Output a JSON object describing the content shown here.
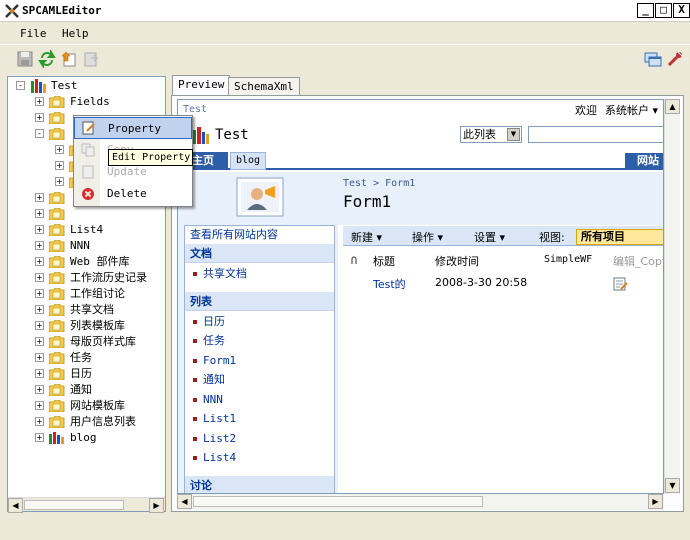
{
  "window": {
    "title": "SPCAMLEditor",
    "minimize": "_",
    "maximize": "□",
    "close": "X"
  },
  "menu": [
    "File",
    "Help"
  ],
  "toolbar": [
    "save-icon",
    "refresh-icon",
    "import-icon",
    "export-icon",
    "window-icon",
    "tool-icon"
  ],
  "tree": {
    "root": "Test",
    "items": [
      {
        "label": "Fields",
        "level": 1,
        "expand": "+"
      },
      {
        "label": "",
        "level": 1,
        "expand": "+"
      },
      {
        "label": "",
        "level": 1,
        "expand": "-"
      },
      {
        "label": "",
        "level": 2,
        "expand": "+"
      },
      {
        "label": "",
        "level": 2,
        "expand": "+"
      },
      {
        "label": "",
        "level": 2,
        "expand": "+"
      },
      {
        "label": "",
        "level": 1,
        "expand": "+"
      },
      {
        "label": "",
        "level": 1,
        "expand": "+"
      },
      {
        "label": "List4",
        "level": 1,
        "expand": "+"
      },
      {
        "label": "NNN",
        "level": 1,
        "expand": "+"
      },
      {
        "label": "Web 部件库",
        "level": 1,
        "expand": "+"
      },
      {
        "label": "工作流历史记录",
        "level": 1,
        "expand": "+"
      },
      {
        "label": "工作组讨论",
        "level": 1,
        "expand": "+"
      },
      {
        "label": "共享文档",
        "level": 1,
        "expand": "+"
      },
      {
        "label": "列表模板库",
        "level": 1,
        "expand": "+"
      },
      {
        "label": "母版页样式库",
        "level": 1,
        "expand": "+"
      },
      {
        "label": "任务",
        "level": 1,
        "expand": "+"
      },
      {
        "label": "日历",
        "level": 1,
        "expand": "+"
      },
      {
        "label": "通知",
        "level": 1,
        "expand": "+"
      },
      {
        "label": "网站模板库",
        "level": 1,
        "expand": "+"
      },
      {
        "label": "用户信息列表",
        "level": 1,
        "expand": "+"
      },
      {
        "label": "blog",
        "level": 1,
        "expand": "+"
      }
    ]
  },
  "context_menu": {
    "items": [
      {
        "label": "Property",
        "icon": "edit-icon",
        "highlighted": true
      },
      {
        "label": "Copy",
        "icon": "copy-icon",
        "disabled": true
      },
      {
        "label": "Update",
        "icon": "update-icon",
        "disabled": true
      },
      {
        "label": "Delete",
        "icon": "delete-icon"
      }
    ],
    "tooltip": "Edit Property"
  },
  "tabs": [
    "Preview",
    "SchemaXml"
  ],
  "preview": {
    "site_name_small": "Test",
    "welcome": "欢迎",
    "account": "系统帐户",
    "site_title": "Test",
    "search_scope": "此列表",
    "nav_home": "主页",
    "nav_blog": "blog",
    "nav_right": "网站",
    "breadcrumb": "Test > Form1",
    "page_title": "Form1",
    "view_all": "查看所有网站内容",
    "sections": [
      {
        "title": "文档",
        "items": [
          {
            "label": "共享文档"
          }
        ]
      },
      {
        "title": "列表",
        "items": [
          {
            "label": "日历"
          },
          {
            "label": "任务"
          },
          {
            "label": "Form1"
          },
          {
            "label": "通知"
          },
          {
            "label": "NNN"
          },
          {
            "label": "List1"
          },
          {
            "label": "List2"
          },
          {
            "label": "List4"
          }
        ]
      },
      {
        "title": "讨论",
        "items": []
      }
    ],
    "list_toolbar": {
      "new": "新建",
      "actions": "操作",
      "settings": "设置",
      "view_label": "视图:",
      "view_value": "所有项目"
    },
    "columns": [
      "标题",
      "修改时间",
      "SimpleWF",
      "编辑_Copy"
    ],
    "rows": [
      {
        "title": "Test的",
        "modified": "2008-3-30 20:58",
        "simplewf": "",
        "edit": "edit-icon"
      }
    ]
  }
}
